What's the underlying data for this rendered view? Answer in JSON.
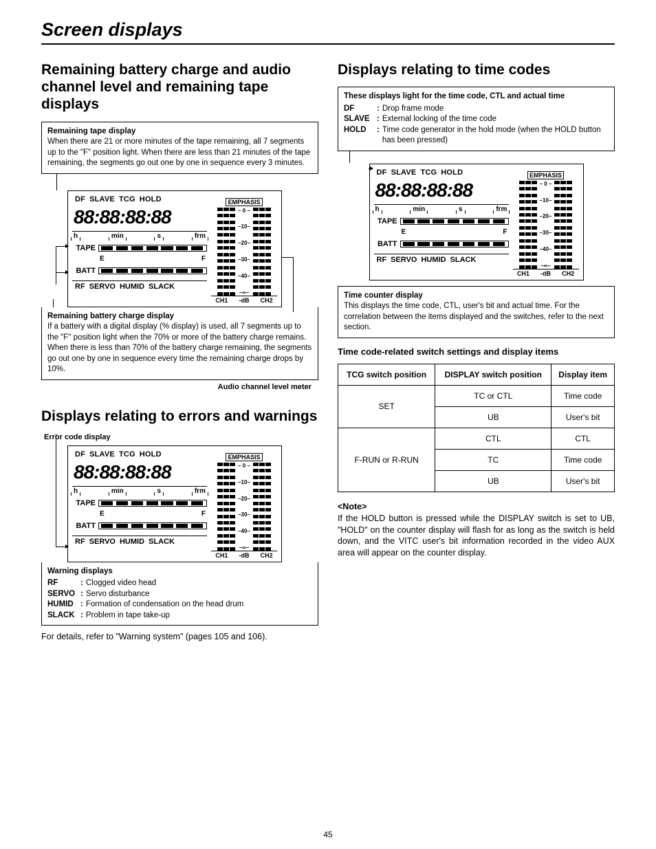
{
  "page_title": "Screen displays",
  "page_number": "45",
  "left": {
    "heading1": "Remaining battery charge and audio channel level and remaining tape displays",
    "box_tape": {
      "title": "Remaining tape display",
      "body": "When there are 21 or more minutes of the tape remaining, all 7 segments up to the \"F\" position light.\nWhen there are less than 21 minutes of the tape remaining, the segments go out one by one in sequence every 3 minutes."
    },
    "box_batt": {
      "title": "Remaining battery charge display",
      "body": "If a battery with a digital display (% display) is used, all 7 segments up to the \"F\" position light when the 70% or more of the battery charge remains.\nWhen there is less than 70% of the battery charge remaining, the segments go out one by one in sequence every time the remaining charge drops by 10%."
    },
    "audio_meter_label": "Audio channel level meter",
    "heading2": "Displays relating to errors and warnings",
    "error_code_label": "Error code display",
    "box_warn": {
      "title": "Warning displays",
      "defs": [
        {
          "term": "RF",
          "desc": "Clogged video head"
        },
        {
          "term": "SERVO",
          "desc": "Servo disturbance"
        },
        {
          "term": "HUMID",
          "desc": "Formation of condensation on the head drum"
        },
        {
          "term": "SLACK",
          "desc": "Problem in tape take-up"
        }
      ]
    },
    "details_text": "For details, refer to \"Warning system\" (pages 105 and 106)."
  },
  "right": {
    "heading": "Displays relating to time codes",
    "box_top": {
      "intro": "These displays light for the time code, CTL and actual time",
      "defs": [
        {
          "term": "DF",
          "desc": "Drop frame mode"
        },
        {
          "term": "SLAVE",
          "desc": "External locking of the time code"
        },
        {
          "term": "HOLD",
          "desc": "Time code generator in the hold mode (when the HOLD button has been pressed)"
        }
      ]
    },
    "box_counter": {
      "title": "Time counter display",
      "body": "This displays the time code, CTL, user's bit and actual time.  For the correlation between the items displayed and the switches, refer to the next section."
    },
    "subhead": "Time code-related switch settings and display items",
    "table": {
      "headers": [
        "TCG switch position",
        "DISPLAY switch position",
        "Display item"
      ],
      "rows": [
        {
          "tcg": "SET",
          "display": "TC or CTL",
          "item": "Time code"
        },
        {
          "tcg": "",
          "display": "UB",
          "item": "User's bit"
        },
        {
          "tcg": "F-RUN or R-RUN",
          "display": "CTL",
          "item": "CTL"
        },
        {
          "tcg": "",
          "display": "TC",
          "item": "Time code"
        },
        {
          "tcg": "",
          "display": "UB",
          "item": "User's bit"
        }
      ]
    },
    "note_label": "<Note>",
    "note_body": "If the HOLD button is pressed while the DISPLAY switch is set to UB, \"HOLD\" on the counter display will flash for as long as the switch is held down, and the VITC user's bit information recorded in the video AUX area will appear on the counter display."
  },
  "panel": {
    "top_labels": [
      "DF",
      "SLAVE",
      "TCG",
      "HOLD"
    ],
    "digits": "88:88:88:88",
    "units": [
      "h",
      "min",
      "s",
      "frm"
    ],
    "tape_label": "TAPE",
    "batt_label": "BATT",
    "e_label": "E",
    "f_label": "F",
    "bottom_labels": [
      "RF",
      "SERVO",
      "HUMID",
      "SLACK"
    ],
    "emphasis": "EMPHASIS",
    "scale": [
      "– 0 –",
      "–10–",
      "–20–",
      "–30–",
      "–40–",
      "–∞–"
    ],
    "ch": [
      "CH1",
      "-dB",
      "CH2"
    ]
  }
}
